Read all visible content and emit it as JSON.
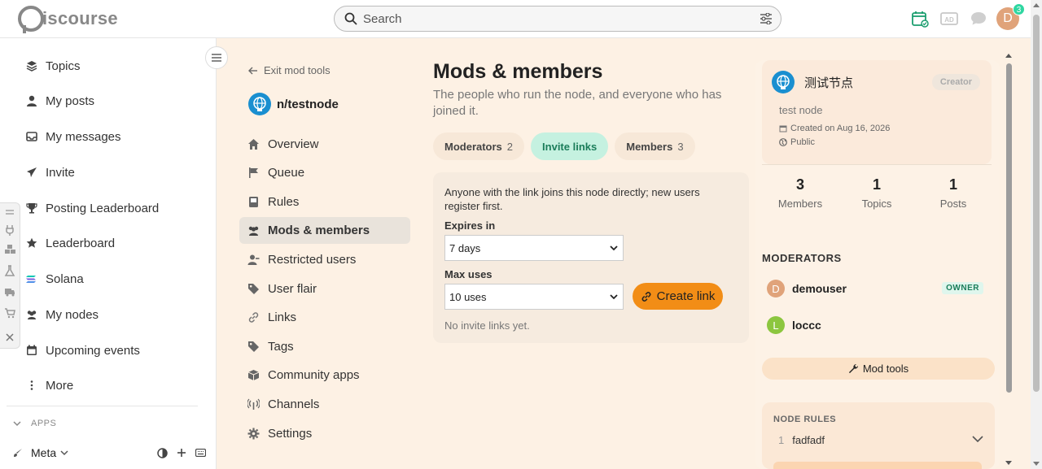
{
  "header": {
    "logo_text": "iscourse",
    "search_placeholder": "Search",
    "avatar_letter": "D",
    "notification_count": "3"
  },
  "sidebar": {
    "items": [
      {
        "label": "Topics",
        "icon": "layers-icon"
      },
      {
        "label": "My posts",
        "icon": "user-icon"
      },
      {
        "label": "My messages",
        "icon": "inbox-icon"
      },
      {
        "label": "Invite",
        "icon": "paper-plane-icon"
      },
      {
        "label": "Posting Leaderboard",
        "icon": "trophy-icon"
      },
      {
        "label": "Leaderboard",
        "icon": "star-icon"
      },
      {
        "label": "Solana",
        "icon": "solana-icon"
      },
      {
        "label": "My nodes",
        "icon": "users-icon"
      },
      {
        "label": "Upcoming events",
        "icon": "calendar-icon"
      },
      {
        "label": "More",
        "icon": "vertical-dots-icon"
      }
    ],
    "apps_label": "APPS",
    "meta_label": "Meta"
  },
  "modnav": {
    "exit_label": "Exit mod tools",
    "node_name": "n/testnode",
    "items": [
      {
        "label": "Overview"
      },
      {
        "label": "Queue"
      },
      {
        "label": "Rules"
      },
      {
        "label": "Mods & members"
      },
      {
        "label": "Restricted users"
      },
      {
        "label": "User flair"
      },
      {
        "label": "Links"
      },
      {
        "label": "Tags"
      },
      {
        "label": "Community apps"
      },
      {
        "label": "Channels"
      },
      {
        "label": "Settings"
      }
    ]
  },
  "content": {
    "title": "Mods & members",
    "subtitle": "The people who run the node, and everyone who has joined it.",
    "tabs": [
      {
        "label": "Moderators",
        "count": "2"
      },
      {
        "label": "Invite links",
        "count": ""
      },
      {
        "label": "Members",
        "count": "3"
      }
    ],
    "invite": {
      "description": "Anyone with the link joins this node directly; new users register first.",
      "expires_label": "Expires in",
      "expires_value": "7 days",
      "max_uses_label": "Max uses",
      "max_uses_value": "10 uses",
      "create_label": "Create link",
      "empty_text": "No invite links yet."
    }
  },
  "panel": {
    "node_name": "测试节点",
    "creator_badge": "Creator",
    "description": "test node",
    "created": "Created on Aug 16, 2026",
    "visibility": "Public",
    "stats": [
      {
        "value": "3",
        "label": "Members"
      },
      {
        "value": "1",
        "label": "Topics"
      },
      {
        "value": "1",
        "label": "Posts"
      }
    ],
    "moderators_heading": "MODERATORS",
    "moderators": [
      {
        "letter": "D",
        "name": "demouser",
        "badge": "OWNER",
        "color": "#e0a37a"
      },
      {
        "letter": "L",
        "name": "loccc",
        "badge": "",
        "color": "#8cc63f"
      }
    ],
    "mod_tools_label": "Mod tools",
    "rules_heading": "NODE RULES",
    "rules": [
      {
        "num": "1",
        "text": "fadfadf"
      }
    ]
  },
  "colors": {
    "accent_orange": "#f28d16",
    "active_tab": "#c5f1e0",
    "page_bg": "#fdf1e4"
  }
}
